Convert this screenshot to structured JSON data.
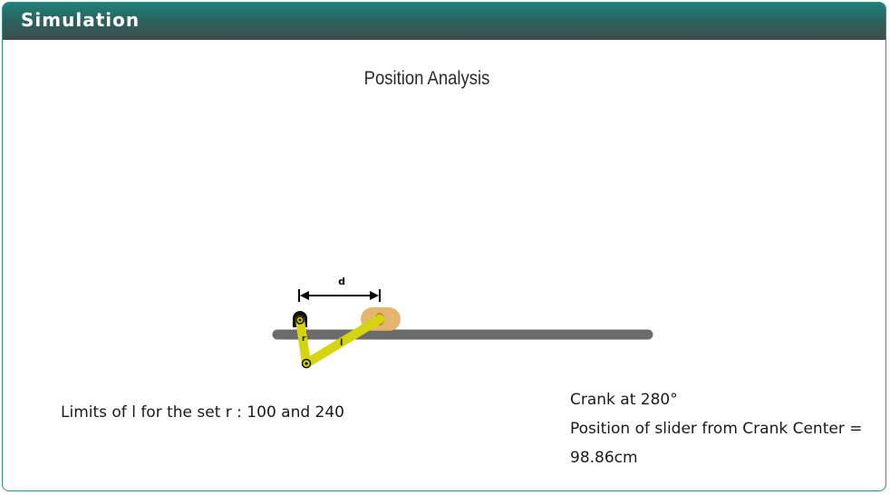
{
  "panel": {
    "title": "Simulation"
  },
  "canvas": {
    "title": "Position Analysis",
    "labels": {
      "d": "d",
      "r": "r",
      "l": "l"
    },
    "colors": {
      "rail": "#6b6b6b",
      "link": "#d4d40f",
      "slider": "#e2ad5f",
      "pivot": "#111111"
    }
  },
  "info": {
    "limits": "Limits of l for the set r : 100 and 240",
    "crank_angle": "Crank at 280°",
    "slider_position_label": "Position of slider from Crank Center =",
    "slider_position_value": "98.86cm"
  }
}
